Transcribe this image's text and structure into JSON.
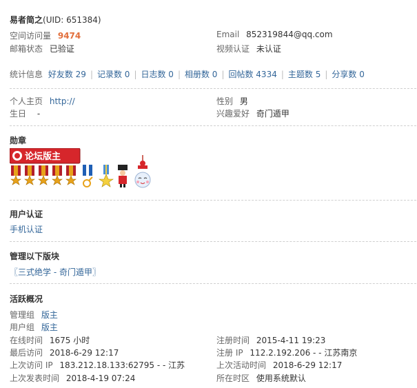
{
  "profile": {
    "name": "易者简之",
    "uid_text": "(UID: 651384)",
    "space_visits_label": "空间访问量",
    "space_visits_value": "9474",
    "email_label": "Email",
    "email_value": "852319844@qq.com",
    "mail_status_label": "邮箱状态",
    "mail_status_value": "已验证",
    "video_label": "视频认证",
    "video_value": "未认证"
  },
  "stats": {
    "label": "统计信息",
    "items": [
      {
        "label": "好友数 29"
      },
      {
        "label": "记录数 0"
      },
      {
        "label": "日志数 0"
      },
      {
        "label": "相册数 0"
      },
      {
        "label": "回帖数 4334"
      },
      {
        "label": "主题数 5"
      },
      {
        "label": "分享数 0"
      }
    ]
  },
  "info": {
    "homepage_label": "个人主页",
    "homepage_value": "http://",
    "gender_label": "性别",
    "gender_value": "男",
    "birthday_label": "生日",
    "birthday_value": "-",
    "hobby_label": "兴趣爱好",
    "hobby_value": "奇门遁甲"
  },
  "medals": {
    "heading": "勋章",
    "banner_text": "论坛版主",
    "colors": {
      "banner": "#d6262b",
      "ribbon": "#b3202a",
      "gold": "#e8a21a",
      "blue": "#1f5fb5"
    }
  },
  "auth": {
    "heading": "用户认证",
    "link": "手机认证"
  },
  "manage": {
    "heading": "管理以下版块",
    "link": "〖三式绝学 - 奇门遁甲〗"
  },
  "activity": {
    "heading": "活跃概况",
    "admin_group_label": "管理组",
    "admin_group_value": "版主",
    "user_group_label": "用户组",
    "user_group_value": "版主",
    "online_label": "在线时间",
    "online_value": "1675 小时",
    "reg_time_label": "注册时间",
    "reg_time_value": "2015-4-11 19:23",
    "last_visit_label": "最后访问",
    "last_visit_value": "2018-6-29 12:17",
    "reg_ip_label": "注册 IP",
    "reg_ip_value": "112.2.192.206 - - 江苏南京",
    "prev_visit_ip_label": "上次访问 IP",
    "prev_visit_ip_value": "183.212.18.133:62795 - - 江苏",
    "prev_active_label": "上次活动时间",
    "prev_active_value": "2018-6-29 12:17",
    "prev_post_label": "上次发表时间",
    "prev_post_value": "2018-4-19 07:24",
    "timezone_label": "所在时区",
    "timezone_value": "使用系统默认"
  }
}
